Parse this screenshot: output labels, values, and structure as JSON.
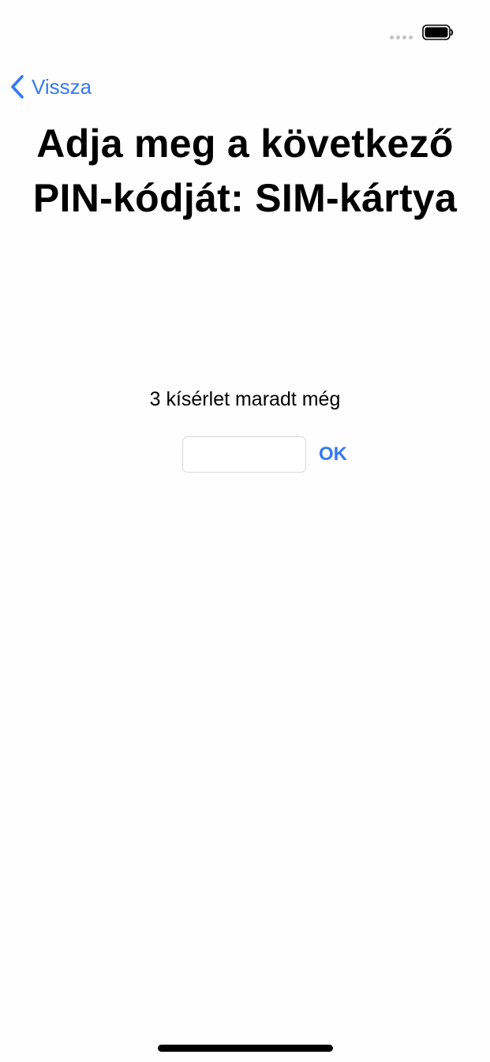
{
  "status_bar": {
    "signal_icon": "signal-dots-icon",
    "battery_icon": "battery-icon"
  },
  "nav": {
    "back_label": "Vissza",
    "back_icon": "chevron-left-icon"
  },
  "page": {
    "title": "Adja meg a következő PIN-kódját: SIM-kártya",
    "attempts_text": "3 kísérlet maradt még"
  },
  "pin_field": {
    "value": "",
    "placeholder": ""
  },
  "ok_button": {
    "label": "OK"
  },
  "colors": {
    "accent": "#3478f6",
    "background": "#fefefe",
    "field_border": "#d8d8dc"
  }
}
